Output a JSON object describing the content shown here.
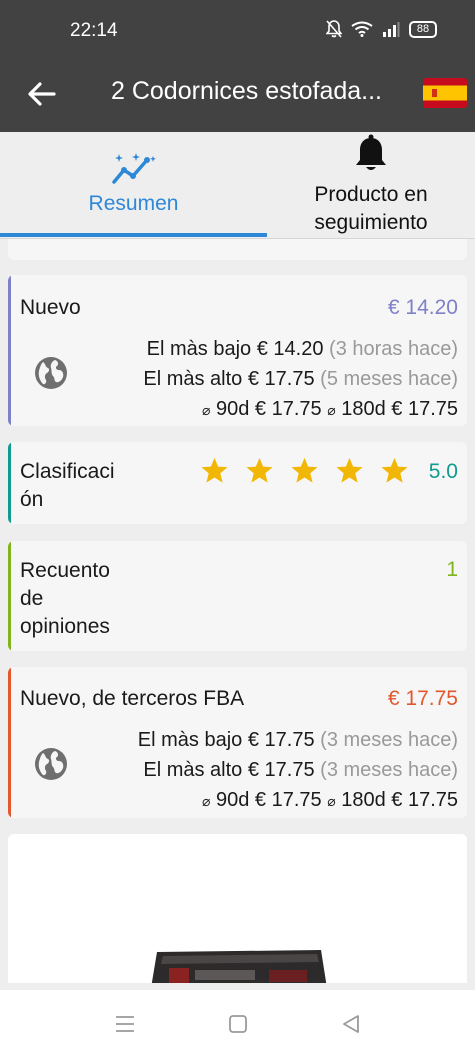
{
  "status": {
    "time": "22:14",
    "battery": "88"
  },
  "appbar": {
    "title": "2 Codornices estofada...",
    "flag_icon": "spain-flag-icon",
    "back_icon": "arrow-back-icon"
  },
  "tabs": [
    {
      "label": "Resumen",
      "icon": "chart-sparkle-icon",
      "active": true
    },
    {
      "label_line1": "Producto en",
      "label_line2": "seguimiento",
      "icon": "bell-icon",
      "active": false
    }
  ],
  "colors": {
    "accent": "#2e88d8",
    "new": "#8080c8",
    "rating": "#0f9b8e",
    "reviews": "#7fb51b",
    "fba": "#e2582c",
    "star": "#f2b705"
  },
  "cards": {
    "new": {
      "label": "Nuevo",
      "price": "€ 14.20",
      "lowest_label": "El màs bajo",
      "lowest_price": "€ 14.20",
      "lowest_time": "(3 horas hace)",
      "highest_label": "El màs alto",
      "highest_price": "€ 17.75",
      "highest_time": "(5 meses hace)",
      "avg_symbol": "⌀",
      "avg90_label": "90d",
      "avg90_price": "€ 17.75",
      "avg180_label": "180d",
      "avg180_price": "€ 17.75"
    },
    "rating": {
      "label_line1": "Clasificaci",
      "label_line2": "ón",
      "value": "5.0",
      "stars": 5
    },
    "reviews": {
      "label_line1": "Recuento",
      "label_line2": "de",
      "label_line3": "opiniones",
      "value": "1"
    },
    "fba": {
      "label": "Nuevo, de terceros FBA",
      "price": "€ 17.75",
      "lowest_label": "El màs bajo",
      "lowest_price": "€ 17.75",
      "lowest_time": "(3 meses hace)",
      "highest_label": "El màs alto",
      "highest_price": "€ 17.75",
      "highest_time": "(3 meses hace)",
      "avg_symbol": "⌀",
      "avg90_label": "90d",
      "avg90_price": "€ 17.75",
      "avg180_label": "180d",
      "avg180_price": "€ 17.75"
    }
  },
  "navbar": {
    "menu_icon": "menu-icon",
    "home_icon": "home-square-icon",
    "back_icon": "back-triangle-icon"
  }
}
